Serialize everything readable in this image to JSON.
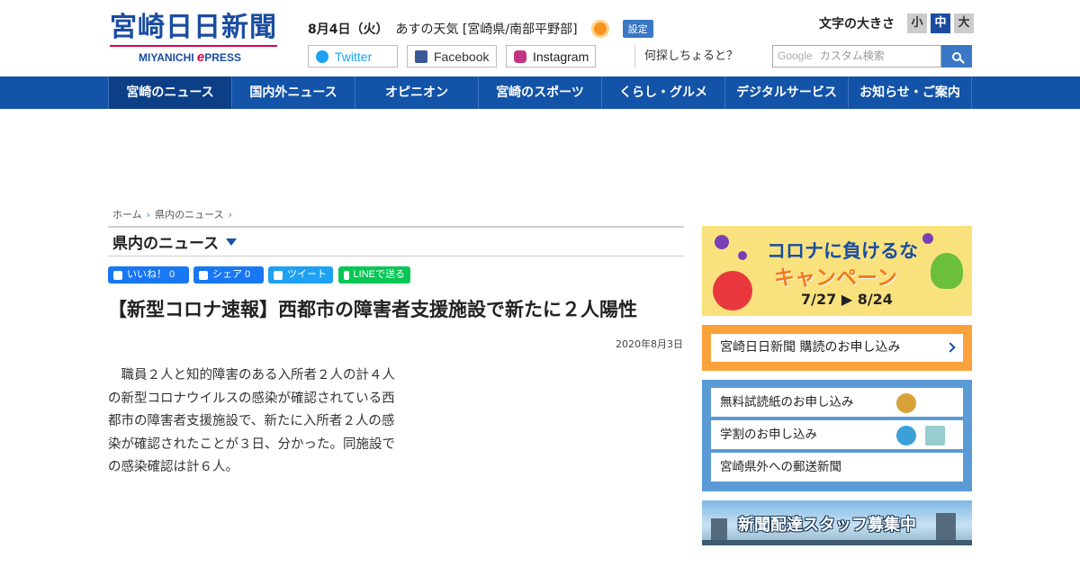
{
  "header": {
    "logo_main": "宮崎日日新聞",
    "logo_sub_a": "MIYANICHI",
    "logo_sub_e": "e",
    "logo_sub_b": "PRESS",
    "date": "8月4日（火）",
    "weather_label": "あすの天気 [宮崎県/南部平野部]",
    "weather_icon": "sun-icon",
    "settings_label": "設定",
    "font_size_label": "文字の大きさ",
    "font_size_small": "小",
    "font_size_medium": "中",
    "font_size_large": "大",
    "social": {
      "twitter": "Twitter",
      "facebook": "Facebook",
      "instagram": "Instagram"
    },
    "search_prompt": "何探しちょると？",
    "search_brand": "Google",
    "search_placeholder": "カスタム検索"
  },
  "nav": {
    "items": [
      "宮崎のニュース",
      "国内外ニュース",
      "オピニオン",
      "宮崎のスポーツ",
      "くらし・グルメ",
      "デジタルサービス",
      "お知らせ・ご案内"
    ]
  },
  "breadcrumb": {
    "home": "ホーム",
    "section": "県内のニュース"
  },
  "section": {
    "title": "県内のニュース"
  },
  "share": {
    "like": "いいね！ 0",
    "fb_share": "シェア 0",
    "tweet": "ツイート",
    "line": "LINEで送る"
  },
  "article": {
    "headline": "【新型コロナ速報】西都市の障害者支援施設で新たに２人陽性",
    "date": "2020年8月3日",
    "body": "　職員２人と知的障害のある入所者２人の計４人の新型コロナウイルスの感染が確認されている西都市の障害者支援施設で、新たに入所者２人の感染が確認されたことが３日、分かった。同施設での感染確認は計６人。"
  },
  "sidebar": {
    "campaign": {
      "title_1": "コロナに負けるな",
      "title_2": "キャンペーン",
      "dates": "7/27 ▶ 8/24"
    },
    "subscribe": "宮崎日日新聞 購読のお申し込み",
    "apply_items": [
      "無料試読紙のお申し込み",
      "学割のお申し込み",
      "宮崎県外への郵送新聞"
    ],
    "recruit": "新聞配達スタッフ募集中"
  },
  "colors": {
    "brand_blue": "#1353a8",
    "accent_pink": "#d6004f",
    "subscribe_orange": "#f9a23a",
    "apply_blue": "#5b9bd5"
  }
}
